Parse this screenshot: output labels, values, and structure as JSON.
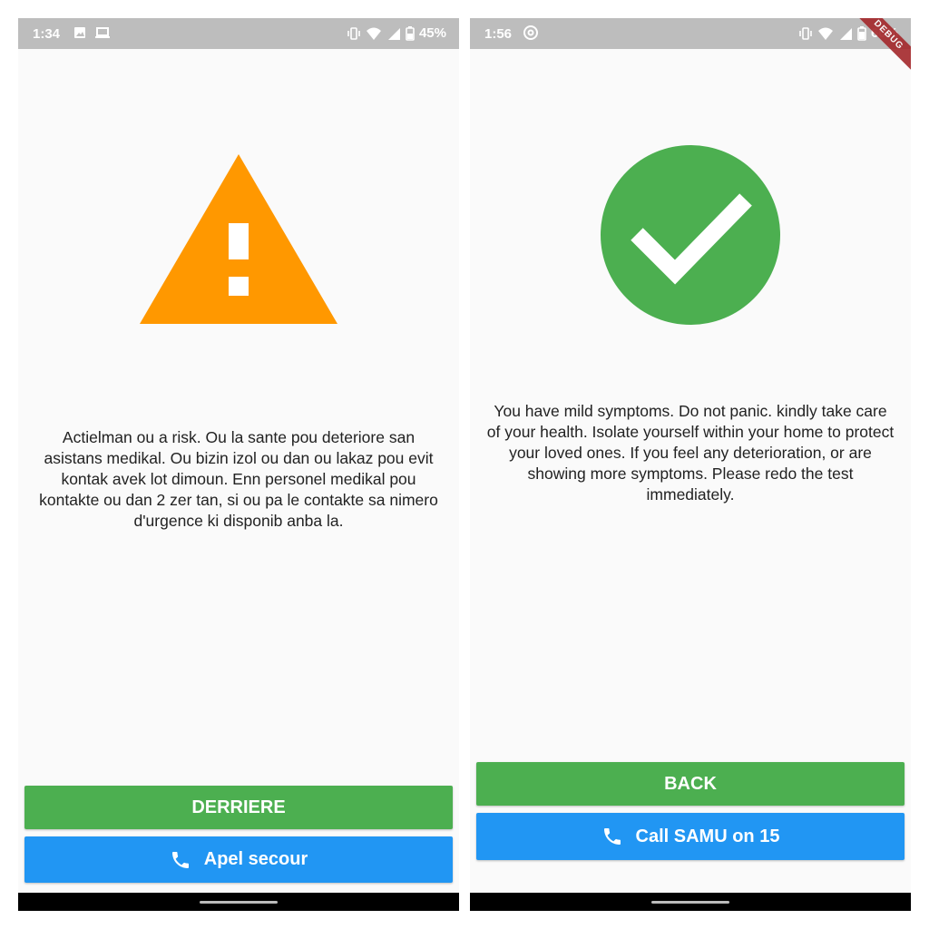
{
  "left_screen": {
    "status": {
      "time": "1:34",
      "battery": "45%",
      "left_icons": [
        "image-icon",
        "laptop-icon"
      ],
      "right_icons": [
        "vibrate-icon",
        "wifi-icon",
        "signal-icon",
        "battery-icon"
      ]
    },
    "alert_icon": "warning-triangle-icon",
    "alert_color": "#ff9800",
    "message": "Actielman ou a risk. Ou la sante pou deteriore san asistans medikal. Ou bizin izol ou dan ou lakaz pou evit kontak avek lot dimoun. Enn personel medikal pou kontakte ou dan 2 zer tan, si ou pa le contakte sa nimero d'urgence ki disponib anba la.",
    "back_button": "DERRIERE",
    "call_button": "Apel secour"
  },
  "right_screen": {
    "status": {
      "time": "1:56",
      "battery": "60%",
      "left_icons": [
        "at-sign-icon"
      ],
      "right_icons": [
        "vibrate-icon",
        "wifi-icon",
        "signal-icon",
        "battery-icon"
      ]
    },
    "debug_banner": "DEBUG",
    "success_icon": "check-circle-icon",
    "success_color": "#4caf50",
    "message": "You have mild symptoms. Do not panic. kindly take care of your health. Isolate yourself within your home to protect your loved ones. If you feel any deterioration, or are showing more symptoms.  Please redo the test immediately.",
    "back_button": "BACK",
    "call_button": "Call SAMU on 15"
  },
  "colors": {
    "green": "#4caf50",
    "blue": "#2196f3",
    "orange": "#ff9800",
    "statusbar": "#bdbdbd"
  }
}
